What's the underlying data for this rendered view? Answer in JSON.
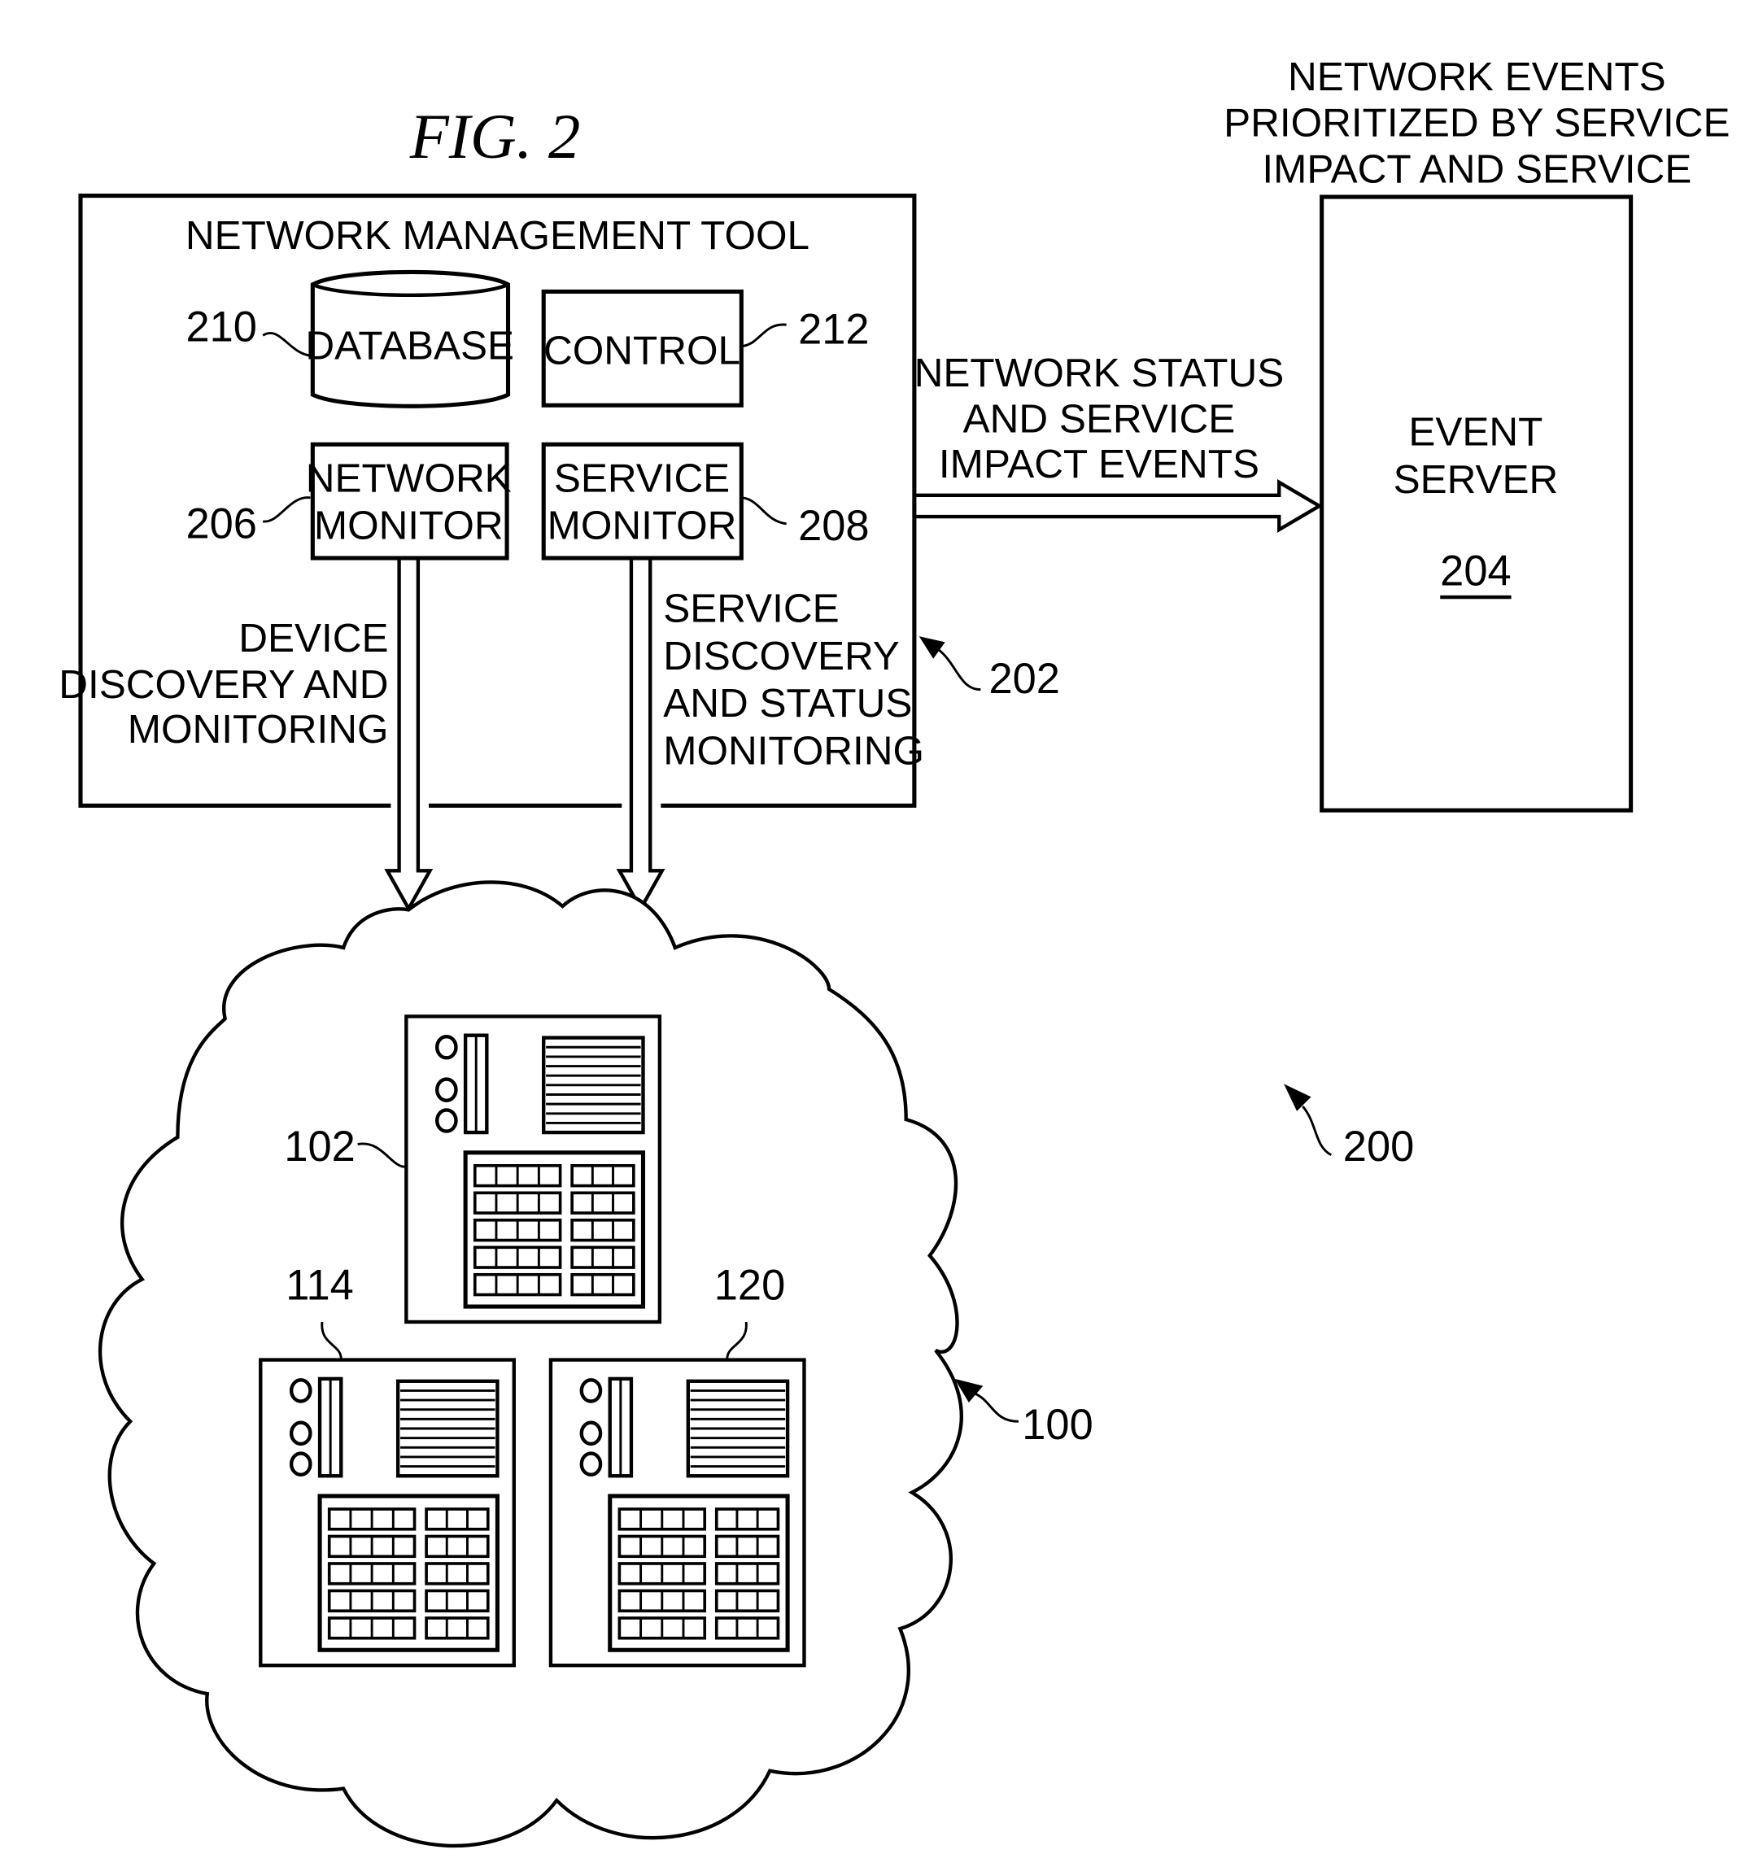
{
  "figure": {
    "title": "FIG. 2",
    "system_ref": "200"
  },
  "network_management_tool": {
    "title": "NETWORK MANAGEMENT TOOL",
    "ref": "202",
    "database": {
      "label": "DATABASE",
      "ref": "210"
    },
    "control": {
      "label": "CONTROL",
      "ref": "212"
    },
    "network_monitor": {
      "label_line1": "NETWORK",
      "label_line2": "MONITOR",
      "ref": "206"
    },
    "service_monitor": {
      "label_line1": "SERVICE",
      "label_line2": "MONITOR",
      "ref": "208"
    }
  },
  "flows": {
    "device_discovery": {
      "line1": "DEVICE",
      "line2": "DISCOVERY AND",
      "line3": "MONITORING"
    },
    "service_discovery": {
      "line1": "SERVICE",
      "line2": "DISCOVERY",
      "line3": "AND STATUS",
      "line4": "MONITORING"
    },
    "events_to_server": {
      "line1": "NETWORK STATUS",
      "line2": "AND SERVICE",
      "line3": "IMPACT EVENTS"
    }
  },
  "event_server": {
    "caption_line1": "NETWORK EVENTS",
    "caption_line2": "PRIORITIZED BY SERVICE",
    "caption_line3": "IMPACT AND SERVICE",
    "label_line1": "EVENT",
    "label_line2": "SERVER",
    "ref": "204"
  },
  "network": {
    "ref": "100",
    "devices": [
      {
        "ref": "102"
      },
      {
        "ref": "114"
      },
      {
        "ref": "120"
      }
    ]
  }
}
